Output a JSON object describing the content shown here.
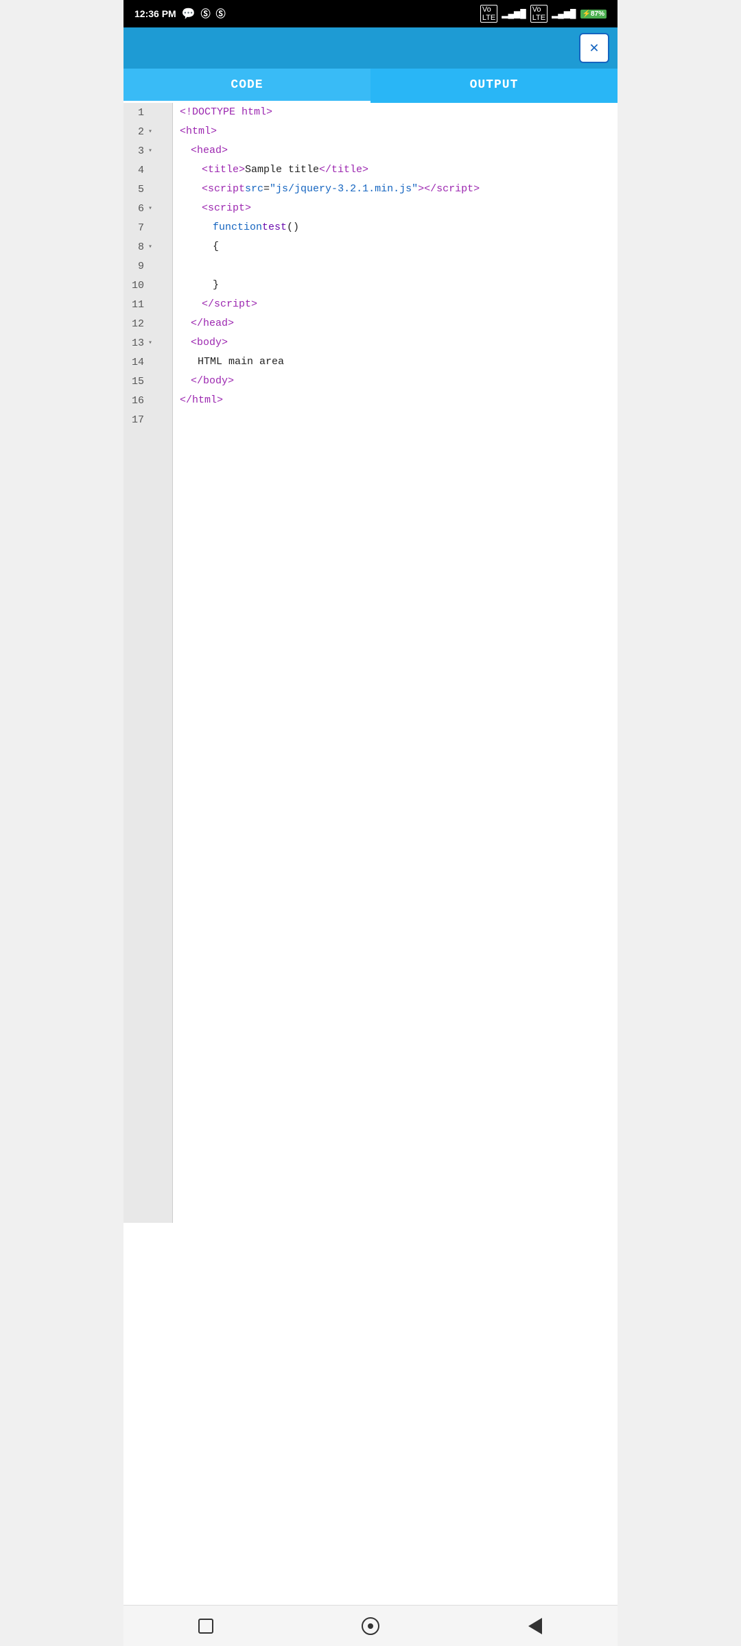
{
  "statusBar": {
    "time": "12:36 PM",
    "battery": "87%"
  },
  "tabs": {
    "code": "CODE",
    "output": "OUTPUT",
    "active": "code"
  },
  "closeButton": "✕",
  "codeLines": [
    {
      "num": 1,
      "fold": false,
      "indent": 0,
      "html": "doctype"
    },
    {
      "num": 2,
      "fold": true,
      "indent": 0,
      "html": "html_open"
    },
    {
      "num": 3,
      "fold": true,
      "indent": 1,
      "html": "head_open"
    },
    {
      "num": 4,
      "fold": false,
      "indent": 2,
      "html": "title"
    },
    {
      "num": 5,
      "fold": false,
      "indent": 2,
      "html": "script_src"
    },
    {
      "num": 6,
      "fold": true,
      "indent": 2,
      "html": "script_open"
    },
    {
      "num": 7,
      "fold": false,
      "indent": 3,
      "html": "function_decl"
    },
    {
      "num": 8,
      "fold": true,
      "indent": 3,
      "html": "brace_open"
    },
    {
      "num": 9,
      "fold": false,
      "indent": 0,
      "html": "empty"
    },
    {
      "num": 10,
      "fold": false,
      "indent": 3,
      "html": "brace_close"
    },
    {
      "num": 11,
      "fold": false,
      "indent": 2,
      "html": "script_close"
    },
    {
      "num": 12,
      "fold": false,
      "indent": 1,
      "html": "head_close"
    },
    {
      "num": 13,
      "fold": true,
      "indent": 1,
      "html": "body_open"
    },
    {
      "num": 14,
      "fold": false,
      "indent": 2,
      "html": "body_text"
    },
    {
      "num": 15,
      "fold": false,
      "indent": 1,
      "html": "body_close"
    },
    {
      "num": 16,
      "fold": false,
      "indent": 0,
      "html": "html_close"
    },
    {
      "num": 17,
      "fold": false,
      "indent": 0,
      "html": "empty"
    }
  ],
  "bottomNav": {
    "square": "stop",
    "circle": "home",
    "back": "back"
  }
}
